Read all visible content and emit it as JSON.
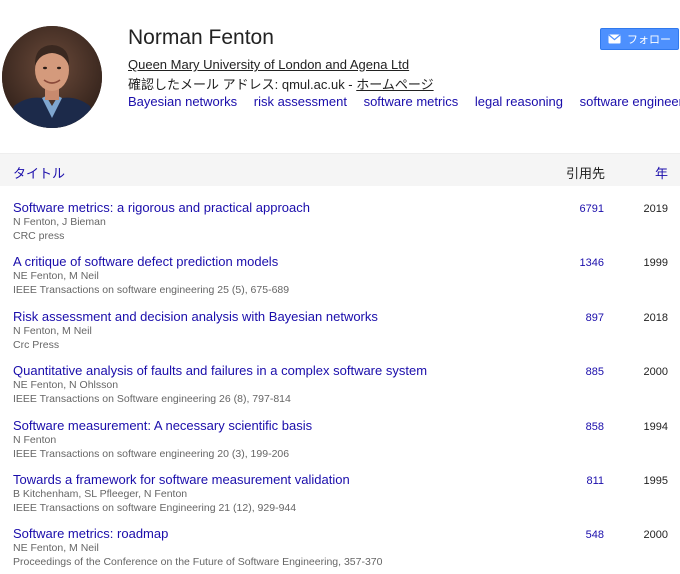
{
  "profile": {
    "name": "Norman Fenton",
    "affiliation": "Queen Mary University of London and Agena Ltd",
    "email_prefix": "確認したメール アドレス: qmul.ac.uk - ",
    "homepage_label": "ホームページ",
    "interests": [
      "Bayesian networks",
      "risk assessment",
      "software metrics",
      "legal reasoning",
      "software engineering"
    ],
    "follow_label": "フォロー",
    "follow_icon": "mail-icon"
  },
  "table": {
    "col_title": "タイトル",
    "col_cited": "引用先",
    "col_year": "年"
  },
  "articles": [
    {
      "title": "Software metrics: a rigorous and practical approach",
      "authors": "N Fenton, J Bieman",
      "venue": "CRC press",
      "cited": "6791",
      "year": "2019"
    },
    {
      "title": "A critique of software defect prediction models",
      "authors": "NE Fenton, M Neil",
      "venue": "IEEE Transactions on software engineering 25 (5), 675-689",
      "cited": "1346",
      "year": "1999"
    },
    {
      "title": "Risk assessment and decision analysis with Bayesian networks",
      "authors": "N Fenton, M Neil",
      "venue": "Crc Press",
      "cited": "897",
      "year": "2018"
    },
    {
      "title": "Quantitative analysis of faults and failures in a complex software system",
      "authors": "NE Fenton, N Ohlsson",
      "venue": "IEEE Transactions on Software engineering 26 (8), 797-814",
      "cited": "885",
      "year": "2000"
    },
    {
      "title": "Software measurement: A necessary scientific basis",
      "authors": "N Fenton",
      "venue": "IEEE Transactions on software engineering 20 (3), 199-206",
      "cited": "858",
      "year": "1994"
    },
    {
      "title": "Towards a framework for software measurement validation",
      "authors": "B Kitchenham, SL Pfleeger, N Fenton",
      "venue": "IEEE Transactions on software Engineering 21 (12), 929-944",
      "cited": "811",
      "year": "1995"
    },
    {
      "title": "Software metrics: roadmap",
      "authors": "NE Fenton, M Neil",
      "venue": "Proceedings of the Conference on the Future of Software Engineering, 357-370",
      "cited": "548",
      "year": "2000"
    }
  ],
  "colors": {
    "link": "#1a0dab",
    "button": "#4d90fe",
    "header_bg": "#f5f5f5"
  }
}
